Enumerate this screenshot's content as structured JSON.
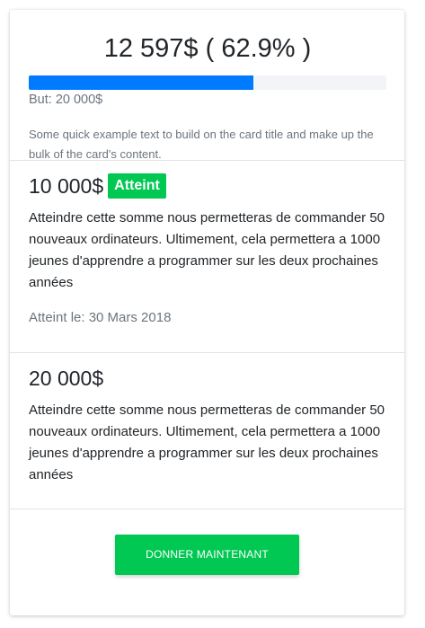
{
  "summary": {
    "amount_label": "12 597$ ( 62.9% )",
    "progress_percent": 62.9,
    "progress_color": "#007bff",
    "goal_label": "But: 20 000$",
    "description": "Some quick example text to build on the card title and make up the bulk of the card's content."
  },
  "milestones": [
    {
      "amount": "10 000$",
      "badge": "Atteint",
      "text": "Atteindre cette somme nous permetteras de commander 50 nouveaux ordinateurs. Ultimement, cela permettera a 1000 jeunes d'apprendre a programmer sur les deux prochaines années",
      "date": "Atteint le: 30 Mars 2018"
    },
    {
      "amount": "20 000$",
      "text": "Atteindre cette somme nous permetteras de commander 50 nouveaux ordinateurs. Ultimement, cela permettera a 1000 jeunes d'apprendre a programmer sur les deux prochaines années"
    }
  ],
  "footer": {
    "donate_label": "DONNER MAINTENANT"
  },
  "colors": {
    "accent_green": "#00c853",
    "progress_blue": "#007bff"
  }
}
